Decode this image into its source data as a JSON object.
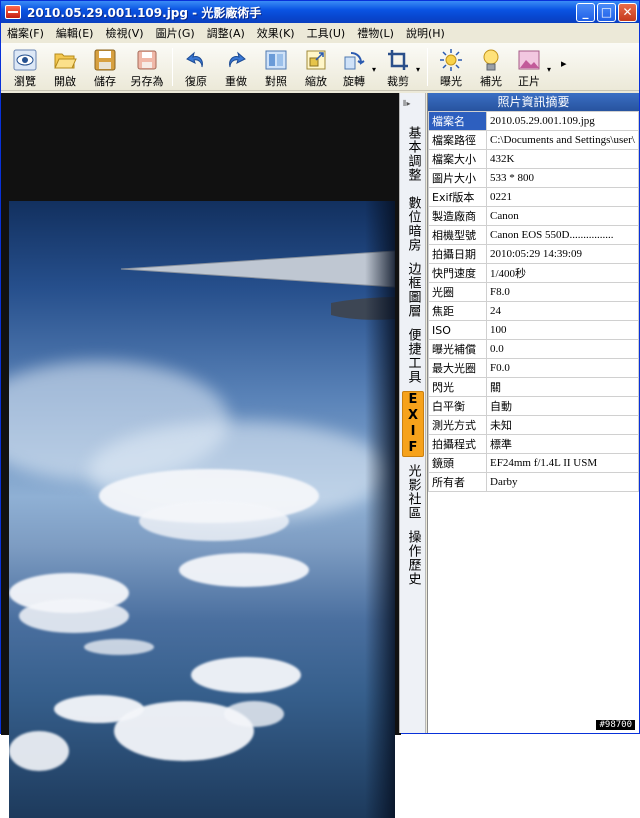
{
  "window": {
    "title": "2010.05.29.001.109.jpg - 光影廠術手",
    "minimize": "_",
    "maximize": "□",
    "close": "✕"
  },
  "menu": [
    "檔案(F)",
    "編輯(E)",
    "檢視(V)",
    "圖片(G)",
    "調整(A)",
    "效果(K)",
    "工具(U)",
    "禮物(L)",
    "說明(H)"
  ],
  "toolbar": {
    "browse": "瀏覽",
    "open": "開啟",
    "save": "儲存",
    "save_as": "另存為",
    "undo": "復原",
    "redo": "重做",
    "compare": "對照",
    "zoom": "縮放",
    "rotate": "旋轉",
    "crop": "裁剪",
    "exposure": "曝光",
    "fill_light": "補光",
    "positive": "正片",
    "more": "▸",
    "dropdown": "▾"
  },
  "side_tabs": [
    "基本調整",
    "數位暗房",
    "边框圖層",
    "便捷工具",
    "EXIF",
    "光影社區",
    "操作歷史"
  ],
  "side_tabs_active": "EXIF",
  "side_grip": "⦀▸",
  "panel": {
    "title": "照片資訊摘要",
    "rows": [
      {
        "key": "檔案名",
        "value": "2010.05.29.001.109.jpg"
      },
      {
        "key": "檔案路徑",
        "value": "C:\\Documents and Settings\\user\\"
      },
      {
        "key": "檔案大小",
        "value": "432K"
      },
      {
        "key": "圖片大小",
        "value": "533 * 800"
      },
      {
        "key": "Exif版本",
        "value": "0221"
      },
      {
        "key": "製造廠商",
        "value": "Canon"
      },
      {
        "key": "相機型號",
        "value": "Canon EOS 550D................"
      },
      {
        "key": "拍攝日期",
        "value": "2010:05:29 14:39:09"
      },
      {
        "key": "快門速度",
        "value": "1/400秒"
      },
      {
        "key": "光圈",
        "value": "F8.0"
      },
      {
        "key": "焦距",
        "value": "24"
      },
      {
        "key": "ISO",
        "value": "100"
      },
      {
        "key": "曝光補償",
        "value": "0.0"
      },
      {
        "key": "最大光圈",
        "value": "F0.0"
      },
      {
        "key": "閃光",
        "value": "關"
      },
      {
        "key": "白平衡",
        "value": "自動"
      },
      {
        "key": "測光方式",
        "value": "未知"
      },
      {
        "key": "拍攝程式",
        "value": "標準"
      },
      {
        "key": "鏡頭",
        "value": "EF24mm f/1.4L II USM"
      },
      {
        "key": "所有者",
        "value": "Darby"
      }
    ]
  },
  "watermark": "#98700",
  "colors": {
    "titlebar": "#0a54e3",
    "selected_row": "#2d5fbf",
    "active_tab": "#f6a21b"
  }
}
